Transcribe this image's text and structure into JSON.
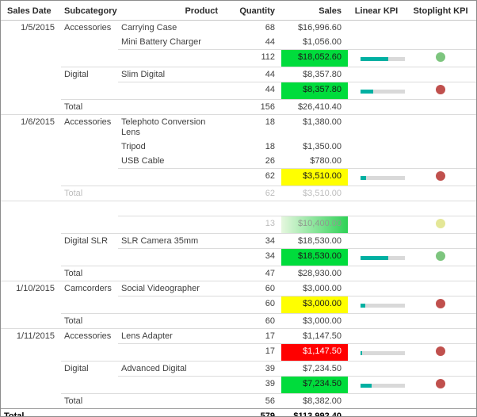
{
  "columns": [
    "Sales Date",
    "Subcategory",
    "Product",
    "Quantity",
    "Sales",
    "Linear KPI",
    "Stoplight KPI"
  ],
  "colors": {
    "sales_green": "#00DC3C",
    "sales_yellow": "#FFFF00",
    "sales_red": "#FF0000",
    "sales_red_text": "#FFFFFF",
    "sales_bg_text": "#1A1A1A",
    "gradient_from": "#E6F7DF",
    "gradient_to": "#2ED256",
    "gradient_text": "#8F9B8F",
    "kpi_fill": "#00B0A2",
    "kpi_track": "#D9D9D9",
    "stoplight_green": "#7DC57E",
    "stoplight_red": "#C0504D",
    "stoplight_paleyellow": "#E4E797"
  },
  "rows": [
    {
      "date": "1/5/2015",
      "subcategory": "Accessories",
      "product": "Carrying Case",
      "quantity": "68",
      "sales": "$16,996.60",
      "type": "detail"
    },
    {
      "product": "Mini Battery Charger",
      "quantity": "44",
      "sales": "$1,056.00",
      "type": "detail"
    },
    {
      "quantity": "112",
      "sales": "$18,052.60",
      "type": "subtotal",
      "sales_bg": "green",
      "kpi": 0.62,
      "stoplight": "green"
    },
    {
      "subcategory": "Digital",
      "product": "Slim Digital",
      "quantity": "44",
      "sales": "$8,357.80",
      "type": "detail",
      "subcat_start": true
    },
    {
      "quantity": "44",
      "sales": "$8,357.80",
      "type": "subtotal",
      "sales_bg": "green",
      "kpi": 0.28,
      "stoplight": "red"
    },
    {
      "subcategory": "Total",
      "quantity": "156",
      "sales": "$26,410.40",
      "type": "total"
    },
    {
      "date": "1/6/2015",
      "subcategory": "Accessories",
      "product": "Telephoto Conversion Lens",
      "quantity": "18",
      "sales": "$1,380.00",
      "type": "detail",
      "group_start": true
    },
    {
      "product": "Tripod",
      "quantity": "18",
      "sales": "$1,350.00",
      "type": "detail"
    },
    {
      "product": "USB Cable",
      "quantity": "26",
      "sales": "$780.00",
      "type": "detail"
    },
    {
      "quantity": "62",
      "sales": "$3,510.00",
      "type": "subtotal",
      "sales_bg": "yellow",
      "kpi": 0.12,
      "stoplight": "red"
    },
    {
      "subcategory": "Total",
      "quantity": "62",
      "sales": "$3,510.00",
      "type": "total",
      "faded": true
    },
    {
      "type": "spacer",
      "group_start": true
    },
    {
      "quantity": "13",
      "sales": "$10,400.00",
      "type": "subtotal",
      "sales_bg": "gradient",
      "stoplight": "paleyellow",
      "faded": true
    },
    {
      "subcategory": "Digital SLR",
      "product": "SLR Camera 35mm",
      "quantity": "34",
      "sales": "$18,530.00",
      "type": "detail",
      "subcat_start": true
    },
    {
      "quantity": "34",
      "sales": "$18,530.00",
      "type": "subtotal",
      "sales_bg": "green",
      "kpi": 0.62,
      "stoplight": "green"
    },
    {
      "subcategory": "Total",
      "quantity": "47",
      "sales": "$28,930.00",
      "type": "total"
    },
    {
      "date": "1/10/2015",
      "subcategory": "Camcorders",
      "product": "Social Videographer",
      "quantity": "60",
      "sales": "$3,000.00",
      "type": "detail",
      "group_start": true
    },
    {
      "quantity": "60",
      "sales": "$3,000.00",
      "type": "subtotal",
      "sales_bg": "yellow",
      "kpi": 0.1,
      "stoplight": "red"
    },
    {
      "subcategory": "Total",
      "quantity": "60",
      "sales": "$3,000.00",
      "type": "total"
    },
    {
      "date": "1/11/2015",
      "subcategory": "Accessories",
      "product": "Lens Adapter",
      "quantity": "17",
      "sales": "$1,147.50",
      "type": "detail",
      "group_start": true
    },
    {
      "quantity": "17",
      "sales": "$1,147.50",
      "type": "subtotal",
      "sales_bg": "red",
      "kpi": 0.04,
      "stoplight": "red"
    },
    {
      "subcategory": "Digital",
      "product": "Advanced Digital",
      "quantity": "39",
      "sales": "$7,234.50",
      "type": "detail",
      "subcat_start": true
    },
    {
      "quantity": "39",
      "sales": "$7,234.50",
      "type": "subtotal",
      "sales_bg": "green",
      "kpi": 0.25,
      "stoplight": "red"
    },
    {
      "subcategory": "Total",
      "quantity": "56",
      "sales": "$8,382.00",
      "type": "total"
    },
    {
      "date": "Total",
      "quantity": "579",
      "sales": "$113,992.40",
      "type": "grand"
    }
  ]
}
